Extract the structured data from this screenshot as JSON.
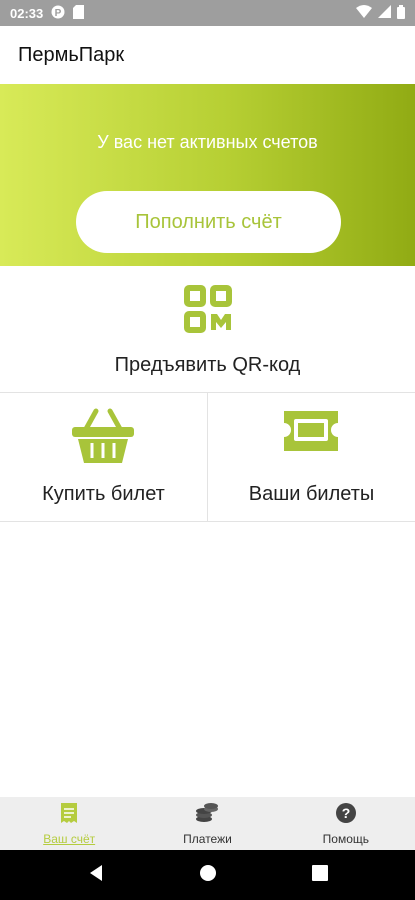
{
  "status_bar": {
    "time": "02:33",
    "icons": [
      "p-circle-icon",
      "sd-card-icon",
      "wifi-icon",
      "signal-icon",
      "battery-icon"
    ]
  },
  "app_bar": {
    "title": "ПермьПарк"
  },
  "account": {
    "message": "У вас нет активных счетов",
    "topup_label": "Пополнить счёт"
  },
  "qr": {
    "label": "Предъявить QR-код",
    "icon": "qr-code-icon"
  },
  "tiles": [
    {
      "label": "Купить билет",
      "icon": "basket-icon"
    },
    {
      "label": "Ваши билеты",
      "icon": "ticket-icon"
    }
  ],
  "bottom_nav": {
    "items": [
      {
        "label": "Ваш счёт",
        "icon": "receipt-icon",
        "active": true
      },
      {
        "label": "Платежи",
        "icon": "coins-icon",
        "active": false
      },
      {
        "label": "Помощь",
        "icon": "help-icon",
        "active": false
      }
    ]
  },
  "colors": {
    "accent": "#b5cc3f",
    "hero_gradient_start": "#d8ea58",
    "hero_gradient_end": "#91ab14",
    "nav_background": "#eeeeee"
  }
}
